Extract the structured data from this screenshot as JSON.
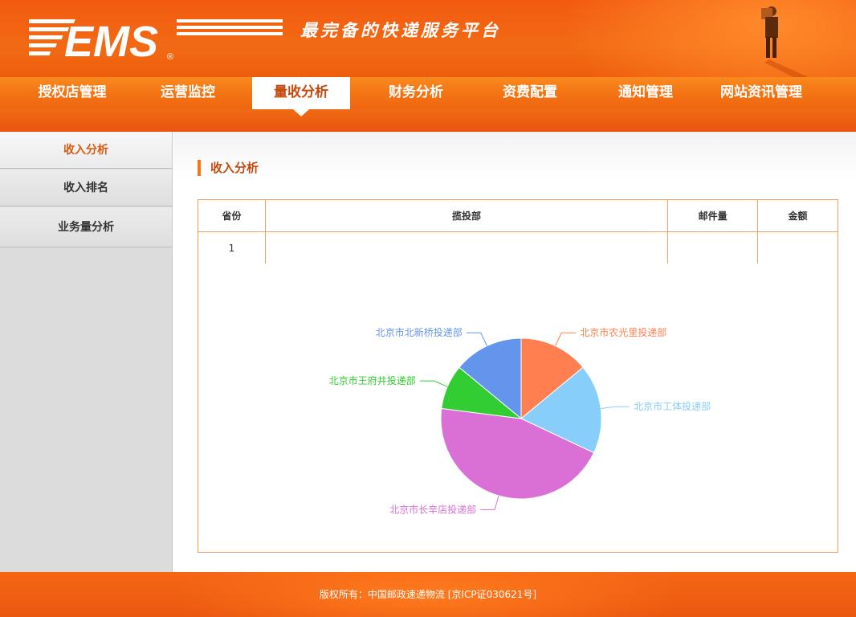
{
  "header": {
    "logo_text": "EMS",
    "slogan": "最完备的快递服务平台"
  },
  "nav": {
    "items": [
      {
        "label": "授权店管理"
      },
      {
        "label": "运营监控"
      },
      {
        "label": "量收分析",
        "active": true
      },
      {
        "label": "财务分析"
      },
      {
        "label": "资费配置"
      },
      {
        "label": "通知管理"
      },
      {
        "label": "网站资讯管理"
      }
    ]
  },
  "sidebar": {
    "items": [
      {
        "label": "收入分析",
        "active": true
      },
      {
        "label": "收入排名"
      },
      {
        "label": "业务量分析"
      }
    ]
  },
  "main": {
    "title": "收入分析",
    "table": {
      "headers": [
        "省份",
        "揽投部",
        "邮件量",
        "金额"
      ],
      "rows": [
        [
          "1",
          "",
          "",
          ""
        ]
      ]
    }
  },
  "chart_data": {
    "type": "pie",
    "categories": [
      "北京市农光里投递部",
      "北京市工体投递部",
      "北京市长辛店投递部",
      "北京市王府井投递部",
      "北京市北新桥投递部"
    ],
    "values": [
      14,
      18,
      45,
      9,
      14
    ],
    "colors": [
      "#ff7f50",
      "#87cefa",
      "#da70d6",
      "#32cd32",
      "#6495ed"
    ]
  },
  "footer": {
    "text": "版权所有：中国邮政速递物流 [京ICP证030621号]"
  }
}
